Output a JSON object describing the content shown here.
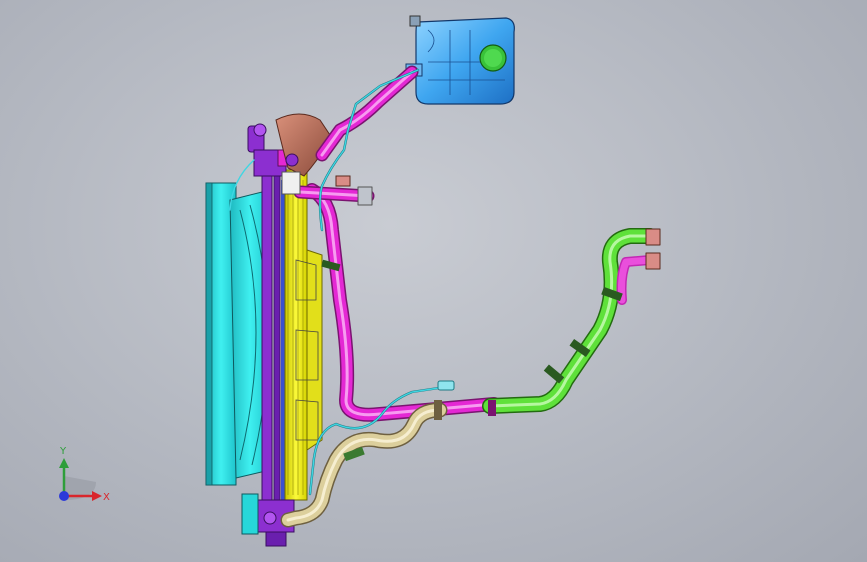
{
  "viewport": {
    "background": "#b8bcc4"
  },
  "triad": {
    "x_label": "X",
    "y_label": "Y",
    "x_color": "#d9262c",
    "y_color": "#2e9e3a",
    "z_color": "#2c3ad9"
  },
  "colors": {
    "radiator_fan": "#27d7d9",
    "radiator_core": "#f2f000",
    "frame_purple": "#8c2fd0",
    "pipe_magenta": "#e428d4",
    "pipe_green": "#5fe13a",
    "pipe_tan": "#dccf9c",
    "expansion_tank": "#3fa6f0",
    "tank_cap": "#39c23a",
    "bracket_brown": "#a8624e",
    "wire_cyan": "#3fd6e2"
  },
  "icons": {
    "triad": "coordinate-triad-icon"
  }
}
